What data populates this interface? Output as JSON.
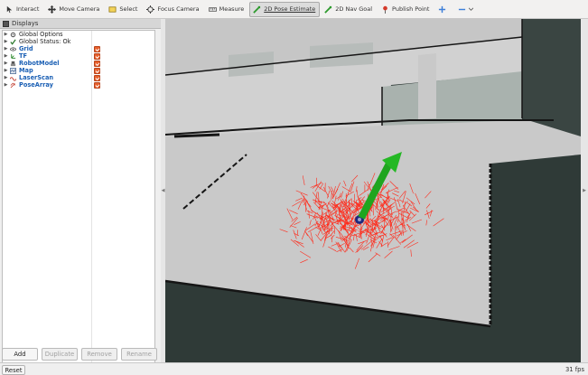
{
  "toolbar": {
    "tools": [
      {
        "label": "Interact",
        "icon": "interact-icon"
      },
      {
        "label": "Move Camera",
        "icon": "move-camera-icon"
      },
      {
        "label": "Select",
        "icon": "select-icon"
      },
      {
        "label": "Focus Camera",
        "icon": "focus-camera-icon"
      },
      {
        "label": "Measure",
        "icon": "measure-icon"
      },
      {
        "label": "2D Pose Estimate",
        "icon": "pose-estimate-icon",
        "active": true
      },
      {
        "label": "2D Nav Goal",
        "icon": "nav-goal-icon"
      },
      {
        "label": "Publish Point",
        "icon": "publish-point-icon"
      }
    ],
    "accent": "#3d7fd9"
  },
  "displays": {
    "title": "Displays",
    "items": [
      {
        "label": "Global Options",
        "style": "plain",
        "icon": "gear-icon",
        "checked": false
      },
      {
        "label": "Global Status: Ok",
        "style": "plain",
        "icon": "check-icon",
        "checked": false
      },
      {
        "label": "Grid",
        "style": "blue",
        "icon": "grid-icon",
        "checked": true
      },
      {
        "label": "TF",
        "style": "blue",
        "icon": "tf-icon",
        "checked": true
      },
      {
        "label": "RobotModel",
        "style": "blue",
        "icon": "robot-icon",
        "checked": true
      },
      {
        "label": "Map",
        "style": "blue",
        "icon": "map-icon",
        "checked": true
      },
      {
        "label": "LaserScan",
        "style": "blue",
        "icon": "laserscan-icon",
        "checked": true
      },
      {
        "label": "PoseArray",
        "style": "blue",
        "icon": "posearray-icon",
        "checked": true
      }
    ],
    "checkbox_color": "#e8602c",
    "buttons": [
      {
        "label": "Add",
        "enabled": true
      },
      {
        "label": "Duplicate",
        "enabled": false
      },
      {
        "label": "Remove",
        "enabled": false
      },
      {
        "label": "Rename",
        "enabled": false
      }
    ]
  },
  "status": {
    "reset_label": "Reset",
    "fps": "31 fps"
  },
  "colors": {
    "floor": "#c8c8c8",
    "background": "#2f3a37",
    "wall": "#111111",
    "particles": "#ff2a1a",
    "goal_arrow": "#1fa51f"
  }
}
